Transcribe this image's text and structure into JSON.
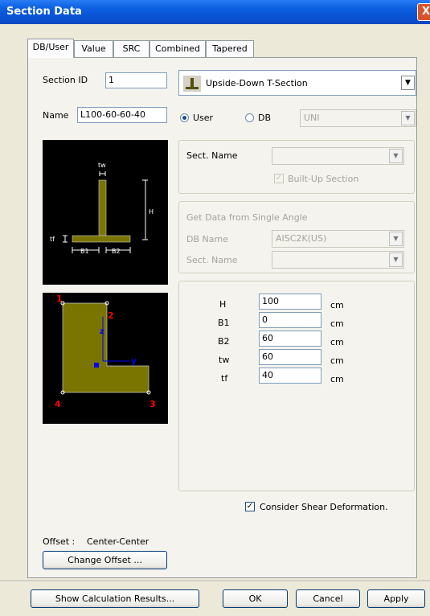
{
  "window": {
    "title": "Section Data",
    "close_glyph": "X"
  },
  "tabs": [
    {
      "label": "DB/User",
      "active": true
    },
    {
      "label": "Value",
      "active": false
    },
    {
      "label": "SRC",
      "active": false
    },
    {
      "label": "Combined",
      "active": false
    },
    {
      "label": "Tapered",
      "active": false
    }
  ],
  "section": {
    "id_label": "Section ID",
    "id_value": "1",
    "name_label": "Name",
    "name_value": "L100-60-60-40",
    "type_value": "Upside-Down T-Section",
    "type_icon": "inverted-t-shape-icon"
  },
  "source": {
    "user_label": "User",
    "db_label": "DB",
    "selected": "User",
    "db_value": "UNI"
  },
  "sect_group": {
    "name_label": "Sect. Name",
    "name_value": "",
    "builtup_label": "Built-Up Section",
    "builtup_checked": true
  },
  "angle_group": {
    "title": "Get Data from Single Angle",
    "db_label": "DB Name",
    "db_value": "AISC2K(US)",
    "sect_label": "Sect. Name",
    "sect_value": ""
  },
  "diagram": {
    "tw": "tw",
    "h": "H",
    "tf": "tf",
    "b1": "B1",
    "b2": "B2"
  },
  "preview": {
    "corner1": "1",
    "corner2": "2",
    "corner3": "3",
    "corner4": "4",
    "axis_z": "z",
    "axis_y": "y",
    "colors": {
      "shape": "#7a7500",
      "corners": "#ff0000",
      "axes": "#0000ff"
    }
  },
  "dims": [
    {
      "label": "H",
      "value": "100",
      "unit": "cm"
    },
    {
      "label": "B1",
      "value": "0",
      "unit": "cm"
    },
    {
      "label": "B2",
      "value": "60",
      "unit": "cm"
    },
    {
      "label": "tw",
      "value": "60",
      "unit": "cm"
    },
    {
      "label": "tf",
      "value": "40",
      "unit": "cm"
    }
  ],
  "shear": {
    "label": "Consider Shear Deformation.",
    "checked": true
  },
  "offset": {
    "label": "Offset :",
    "value": "Center-Center",
    "button": "Change Offset ..."
  },
  "footer": {
    "calc": "Show Calculation Results...",
    "ok": "OK",
    "cancel": "Cancel",
    "apply": "Apply"
  }
}
